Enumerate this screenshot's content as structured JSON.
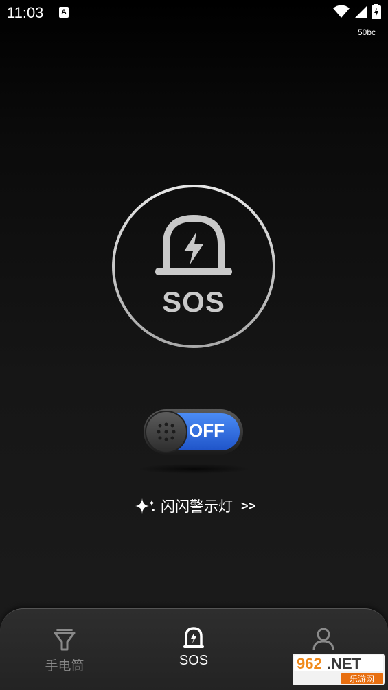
{
  "status_bar": {
    "time": "11:03",
    "notification_icon": "A",
    "network_label": "50bc",
    "icons": [
      "wifi-icon",
      "signal-icon",
      "battery-charging-icon"
    ]
  },
  "sos_button": {
    "label": "SOS",
    "icon": "siren-lightning-icon"
  },
  "toggle": {
    "state_label": "OFF",
    "accent_color": "#2f6fe0"
  },
  "warning_link": {
    "label": "闪闪警示灯",
    "arrows": ">>",
    "icon": "sparkle-icon"
  },
  "bottom_nav": {
    "items": [
      {
        "label": "手电筒",
        "icon": "flashlight-icon",
        "active": false
      },
      {
        "label": "SOS",
        "icon": "siren-icon",
        "active": true
      },
      {
        "label": "",
        "icon": "person-icon",
        "active": false
      }
    ]
  },
  "watermark": {
    "text_top": "962.NET",
    "text_bottom": "乐游网"
  }
}
